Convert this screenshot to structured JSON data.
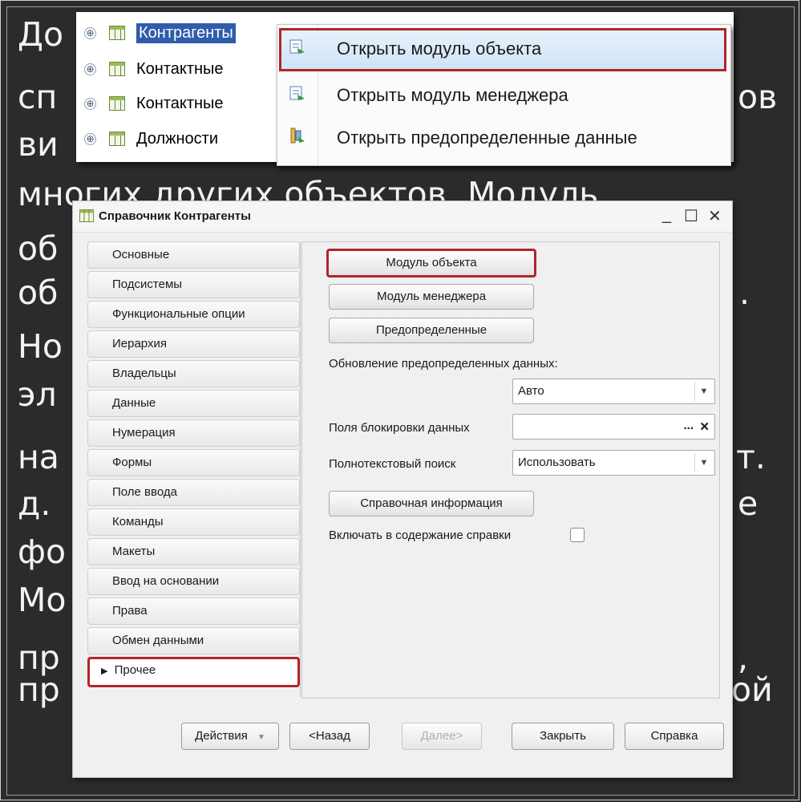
{
  "slide": {
    "lines": [
      "До",
      "сп",
      "ви",
      "многих других объектов. Модуль",
      "об",
      "об",
      "Но",
      "эл",
      "на",
      "д.",
      "фо",
      "Мо",
      "пр",
      "пр"
    ],
    "right_fragments": [
      "ов",
      ".",
      "т.",
      "е",
      ",",
      "ой"
    ]
  },
  "tree": {
    "items": [
      {
        "label": "Контрагенты"
      },
      {
        "label": "Контактные"
      },
      {
        "label": "Контактные"
      },
      {
        "label": "Должности"
      }
    ],
    "expander": "⊕"
  },
  "context_menu": {
    "items": [
      {
        "label": "Открыть модуль объекта"
      },
      {
        "label": "Открыть модуль менеджера"
      },
      {
        "label": "Открыть предопределенные данные"
      }
    ]
  },
  "dialog": {
    "title": "Справочник Контрагенты",
    "controls": {
      "minimize": "_",
      "maximize": "☐",
      "close": "✕"
    },
    "nav": [
      "Основные",
      "Подсистемы",
      "Функциональные опции",
      "Иерархия",
      "Владельцы",
      "Данные",
      "Нумерация",
      "Формы",
      "Поле ввода",
      "Команды",
      "Макеты",
      "Ввод на основании",
      "Права",
      "Обмен данными",
      "Прочее"
    ],
    "active_marker": "▶",
    "content": {
      "btn_object_module": "Модуль объекта",
      "btn_manager_module": "Модуль менеджера",
      "btn_predefined": "Предопределенные",
      "update_label": "Обновление предопределенных данных:",
      "update_value": "Авто",
      "lock_fields_label": "Поля блокировки данных",
      "lock_fields_value": "",
      "lock_dots": "...",
      "lock_clear": "✕",
      "fulltext_label": "Полнотекстовый поиск",
      "fulltext_value": "Использовать",
      "btn_help_info": "Справочная информация",
      "include_help_label": "Включать в содержание справки",
      "include_help_checked": false
    },
    "footer": {
      "actions": "Действия",
      "back": "<Назад",
      "next": "Далее>",
      "close": "Закрыть",
      "help": "Справка"
    }
  }
}
